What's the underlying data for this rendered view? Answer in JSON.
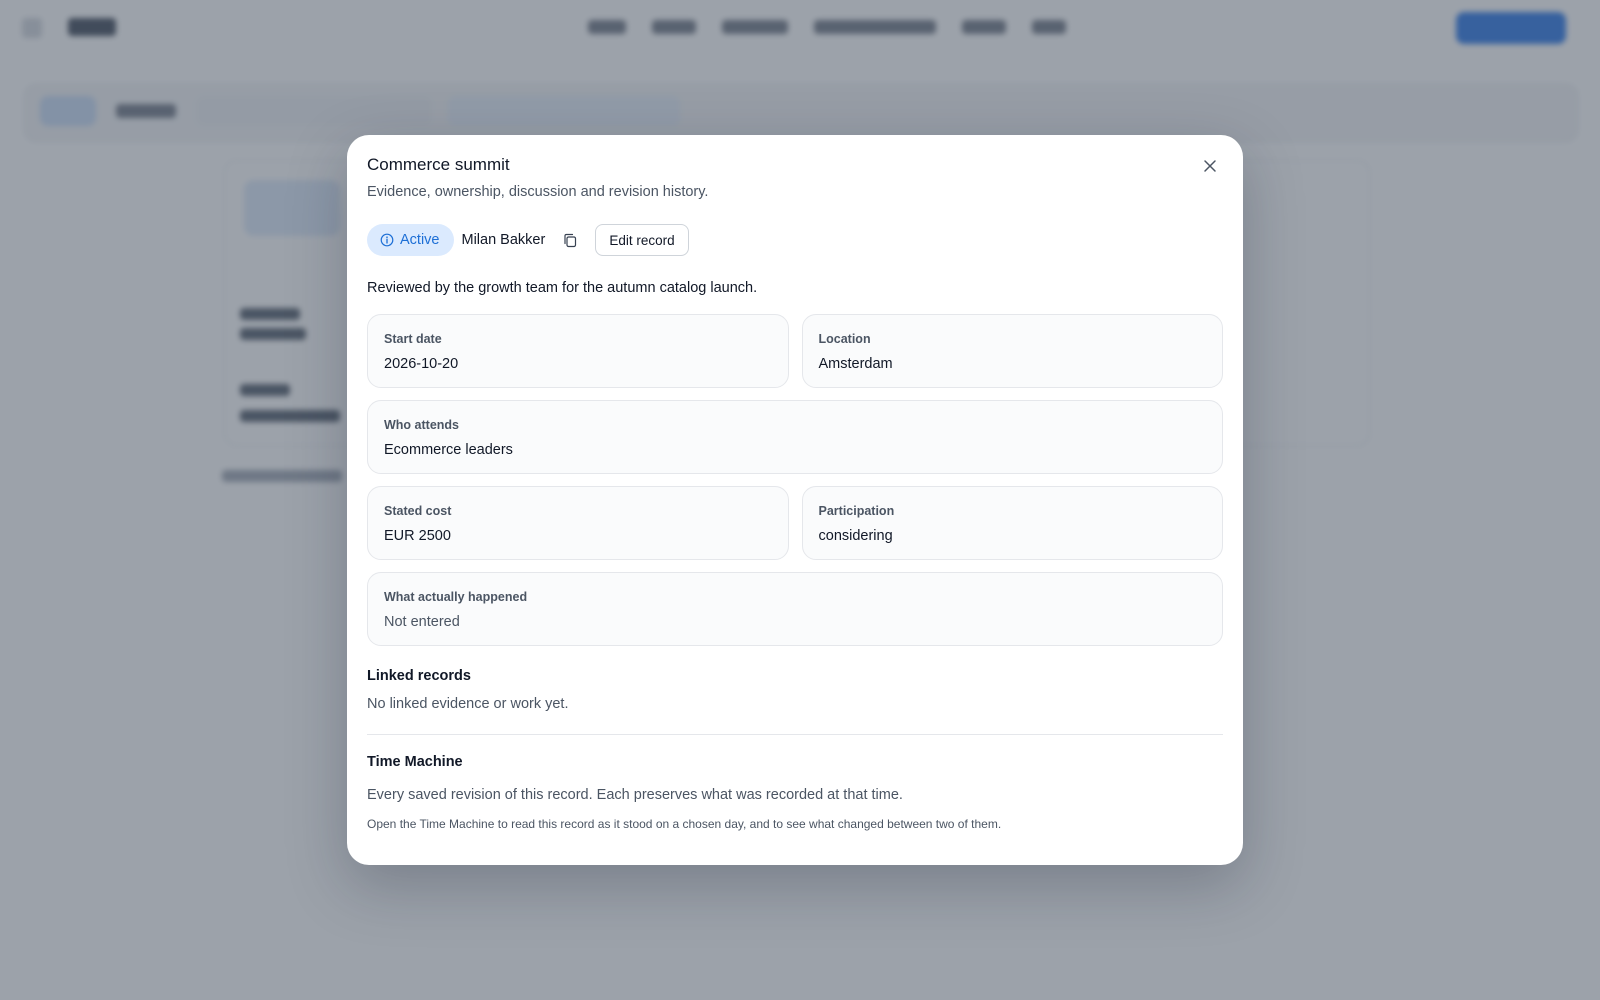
{
  "modal": {
    "title": "Commerce summit",
    "subtitle": "Evidence, ownership, discussion and revision history.",
    "close_icon": "close-icon",
    "status": {
      "label": "Active",
      "icon": "info-icon",
      "color": "#1d6fd6",
      "bg": "#dbeafe"
    },
    "owner": "Milan Bakker",
    "copy_icon": "copy-icon",
    "edit_label": "Edit record",
    "description": "Reviewed by the growth team for the autumn catalog launch.",
    "fields": {
      "start_date": {
        "label": "Start date",
        "value": "2026-10-20"
      },
      "location": {
        "label": "Location",
        "value": "Amsterdam"
      },
      "who_attends": {
        "label": "Who attends",
        "value": "Ecommerce leaders"
      },
      "stated_cost": {
        "label": "Stated cost",
        "value": "EUR 2500"
      },
      "participation": {
        "label": "Participation",
        "value": "considering"
      },
      "what_happened": {
        "label": "What actually happened",
        "value": "Not entered"
      }
    },
    "linked": {
      "heading": "Linked records",
      "empty_text": "No linked evidence or work yet."
    },
    "time_machine": {
      "heading": "Time Machine",
      "description": "Every saved revision of this record. Each preserves what was recorded at that time.",
      "hint": "Open the Time Machine to read this record as it stood on a chosen day, and to see what changed between two of them."
    }
  },
  "colors": {
    "accent": "#1f6fe5",
    "scrim": "rgba(75,86,100,0.55)"
  }
}
